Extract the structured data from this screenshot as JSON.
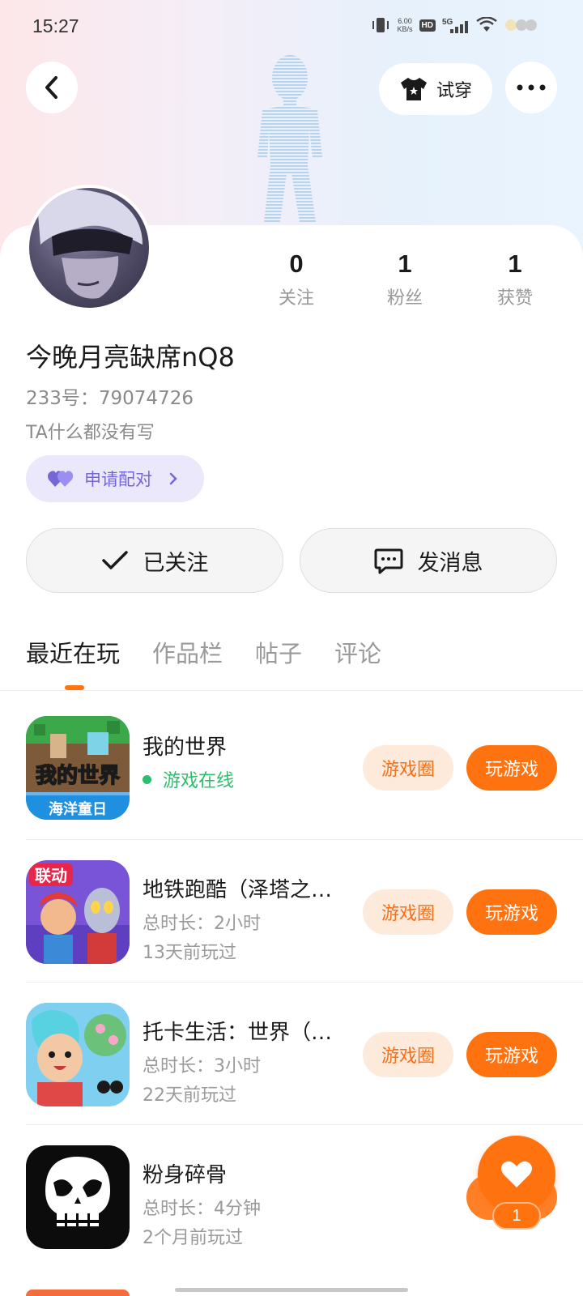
{
  "status_bar": {
    "time": "15:27",
    "net_speed_value": "6.00",
    "net_speed_unit": "KB/s",
    "hd": "HD",
    "network": "5G"
  },
  "header": {
    "back_icon": "chevron-left-icon",
    "try_on_label": "试穿",
    "try_on_icon": "tshirt-icon",
    "more_icon": "more-dots-icon"
  },
  "profile": {
    "username": "今晚月亮缺席nQ8",
    "uid_line": "233号：79074726",
    "bio": "TA什么都没有写",
    "pair_label": "申请配对",
    "stats": [
      {
        "value": "0",
        "label": "关注"
      },
      {
        "value": "1",
        "label": "粉丝"
      },
      {
        "value": "1",
        "label": "获赞"
      }
    ],
    "follow_label": "已关注",
    "message_label": "发消息"
  },
  "tabs": [
    {
      "label": "最近在玩",
      "active": true
    },
    {
      "label": "作品栏",
      "active": false
    },
    {
      "label": "帖子",
      "active": false
    },
    {
      "label": "评论",
      "active": false
    }
  ],
  "games": [
    {
      "name": "我的世界",
      "online_label": "游戏在线",
      "circle_label": "游戏圈",
      "play_label": "玩游戏",
      "icon_text_top": "我的世界",
      "icon_text_bottom": "海洋童日"
    },
    {
      "name": "地铁跑酷（泽塔之…",
      "duration": "总时长：2小时",
      "last_played": "13天前玩过",
      "circle_label": "游戏圈",
      "play_label": "玩游戏",
      "icon_text": "联动"
    },
    {
      "name": "托卡生活：世界（…",
      "duration": "总时长：3小时",
      "last_played": "22天前玩过",
      "circle_label": "游戏圈",
      "play_label": "玩游戏"
    },
    {
      "name": "粉身碎骨",
      "duration": "总时长：4分钟",
      "last_played": "2个月前玩过"
    }
  ],
  "like_fab": {
    "count": "1",
    "icon": "heart-icon"
  },
  "colors": {
    "accent": "#ff7210",
    "online": "#2ebd6c",
    "pair": "#7567d8"
  }
}
